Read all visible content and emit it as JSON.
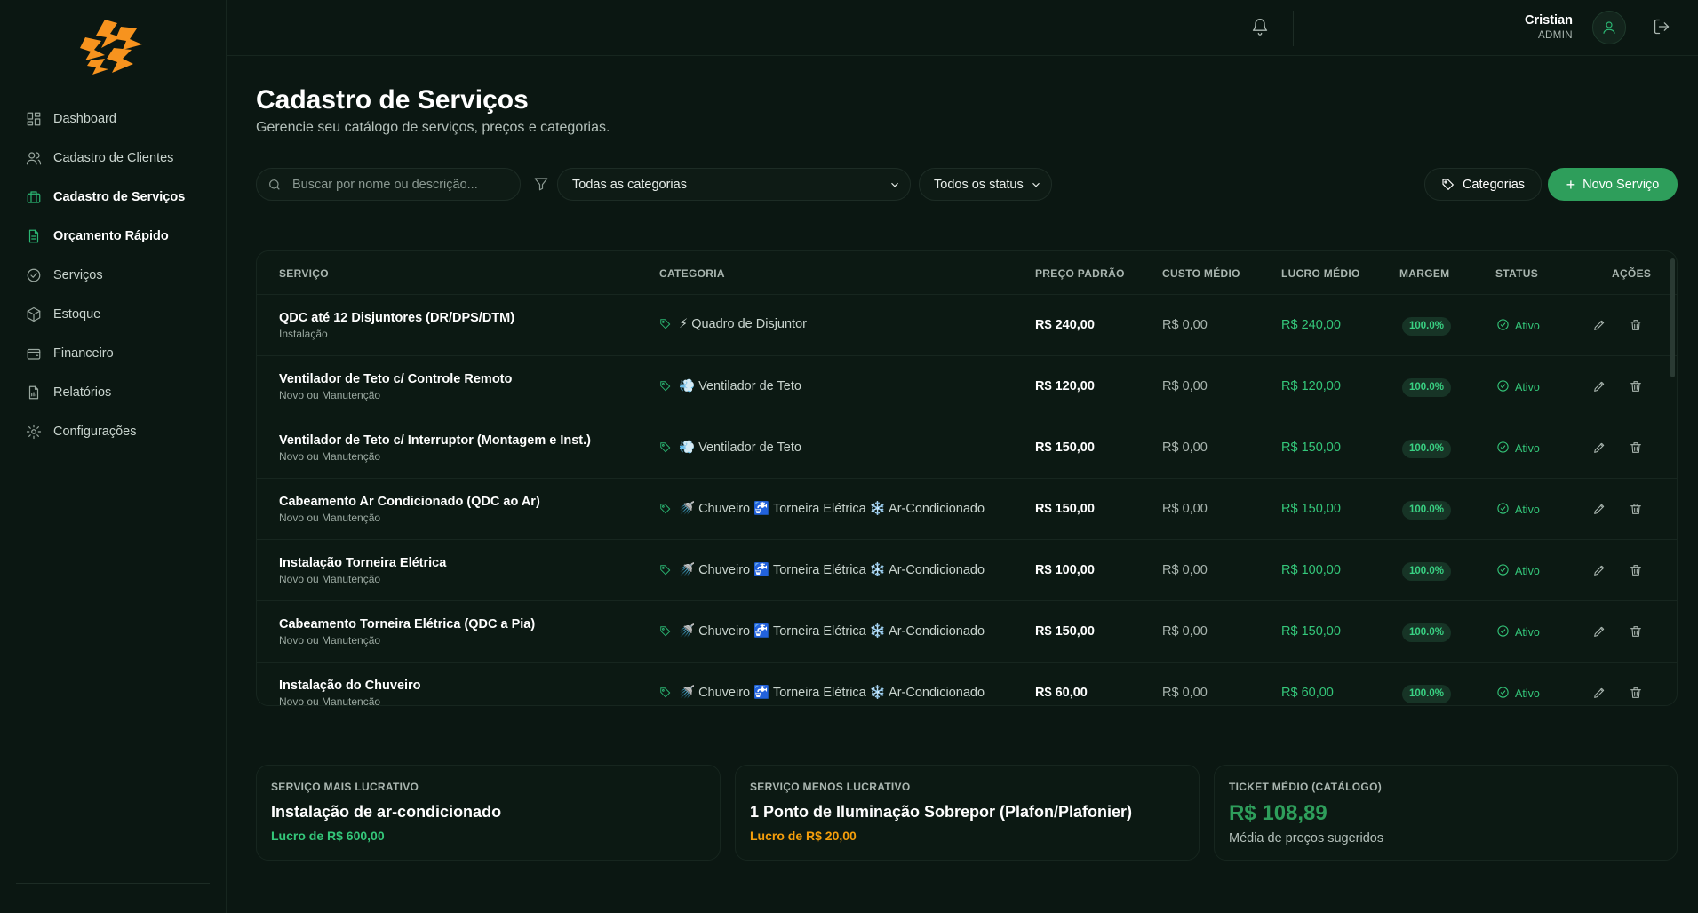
{
  "sidebar": {
    "items": [
      {
        "label": "Dashboard",
        "icon": "dashboard-icon"
      },
      {
        "label": "Cadastro de Clientes",
        "icon": "users-icon"
      },
      {
        "label": "Cadastro de Serviços",
        "icon": "briefcase-icon"
      },
      {
        "label": "Orçamento Rápido",
        "icon": "file-icon"
      },
      {
        "label": "Serviços",
        "icon": "check-circle-icon"
      },
      {
        "label": "Estoque",
        "icon": "box-icon"
      },
      {
        "label": "Financeiro",
        "icon": "wallet-icon"
      },
      {
        "label": "Relatórios",
        "icon": "report-icon"
      },
      {
        "label": "Configurações",
        "icon": "gear-icon"
      }
    ]
  },
  "topbar": {
    "user_name": "Cristian",
    "user_role": "ADMIN"
  },
  "header": {
    "title": "Cadastro de Serviços",
    "subtitle": "Gerencie seu catálogo de serviços, preços e categorias."
  },
  "toolbar": {
    "search_placeholder": "Buscar por nome ou descrição...",
    "category_filter": "Todas as categorias",
    "status_filter": "Todos os status",
    "categories_label": "Categorias",
    "new_label": "Novo Serviço"
  },
  "table": {
    "headers": {
      "service": "SERVIÇO",
      "category": "CATEGORIA",
      "price": "PREÇO PADRÃO",
      "cost": "CUSTO MÉDIO",
      "profit": "LUCRO MÉDIO",
      "margin": "MARGEM",
      "status": "STATUS",
      "actions": "AÇÕES"
    },
    "rows": [
      {
        "name": "QDC até 12 Disjuntores (DR/DPS/DTM)",
        "sub": "Instalação",
        "category": "⚡ Quadro de Disjuntor",
        "price": "R$ 240,00",
        "cost": "R$ 0,00",
        "profit": "R$ 240,00",
        "margin": "100.0%",
        "status": "Ativo"
      },
      {
        "name": "Ventilador de Teto c/ Controle Remoto",
        "sub": "Novo ou Manutenção",
        "category": "💨 Ventilador de Teto",
        "price": "R$ 120,00",
        "cost": "R$ 0,00",
        "profit": "R$ 120,00",
        "margin": "100.0%",
        "status": "Ativo"
      },
      {
        "name": "Ventilador de Teto c/ Interruptor (Montagem e Inst.)",
        "sub": "Novo ou Manutenção",
        "category": "💨 Ventilador de Teto",
        "price": "R$ 150,00",
        "cost": "R$ 0,00",
        "profit": "R$ 150,00",
        "margin": "100.0%",
        "status": "Ativo"
      },
      {
        "name": "Cabeamento Ar Condicionado (QDC ao Ar)",
        "sub": "Novo ou Manutenção",
        "category": "🚿 Chuveiro 🚰 Torneira Elétrica ❄️ Ar-Condicionado",
        "price": "R$ 150,00",
        "cost": "R$ 0,00",
        "profit": "R$ 150,00",
        "margin": "100.0%",
        "status": "Ativo"
      },
      {
        "name": "Instalação Torneira Elétrica",
        "sub": "Novo ou Manutenção",
        "category": "🚿 Chuveiro 🚰 Torneira Elétrica ❄️ Ar-Condicionado",
        "price": "R$ 100,00",
        "cost": "R$ 0,00",
        "profit": "R$ 100,00",
        "margin": "100.0%",
        "status": "Ativo"
      },
      {
        "name": "Cabeamento Torneira Elétrica (QDC a Pia)",
        "sub": "Novo ou Manutenção",
        "category": "🚿 Chuveiro 🚰 Torneira Elétrica ❄️ Ar-Condicionado",
        "price": "R$ 150,00",
        "cost": "R$ 0,00",
        "profit": "R$ 150,00",
        "margin": "100.0%",
        "status": "Ativo"
      },
      {
        "name": "Instalação do Chuveiro",
        "sub": "Novo ou Manutenção",
        "category": "🚿 Chuveiro 🚰 Torneira Elétrica ❄️ Ar-Condicionado",
        "price": "R$ 60,00",
        "cost": "R$ 0,00",
        "profit": "R$ 60,00",
        "margin": "100.0%",
        "status": "Ativo"
      }
    ]
  },
  "summary": {
    "most": {
      "label": "SERVIÇO MAIS LUCRATIVO",
      "name": "Instalação de ar-condicionado",
      "note": "Lucro de R$ 600,00"
    },
    "least": {
      "label": "SERVIÇO MENOS LUCRATIVO",
      "name": "1 Ponto de Iluminação Sobrepor (Plafon/Plafonier)",
      "note": "Lucro de R$ 20,00"
    },
    "ticket": {
      "label": "TICKET MÉDIO (CATÁLOGO)",
      "value": "R$ 108,89",
      "note": "Média de preços sugeridos"
    }
  },
  "colors": {
    "background": "#0b1712",
    "accent": "#2e9e5b",
    "profit": "#34c77a",
    "warning": "#f59e0b",
    "logo": "#f7931e"
  }
}
